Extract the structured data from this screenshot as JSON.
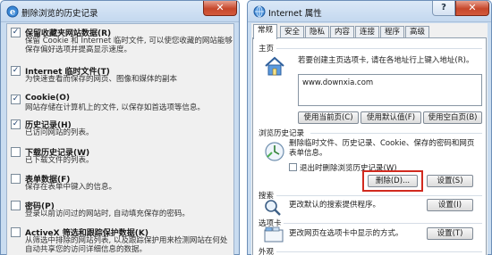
{
  "left_dialog": {
    "title": "删除浏览的历史记录",
    "close_glyph": "✕",
    "options": [
      {
        "label": "保留收藏夹网站数据(R)",
        "description": "保留 Cookie 和 Internet 临时文件, 可以使您收藏的网站能够保存偏好选项并提高显示速度。",
        "checked": true
      },
      {
        "label": "Internet 临时文件(T)",
        "description": "为快速查看而保存的网页、图像和媒体的副本",
        "checked": true
      },
      {
        "label": "Cookie(O)",
        "description": "网站存储在计算机上的文件, 以保存如首选项等信息。",
        "checked": true
      },
      {
        "label": "历史记录(H)",
        "description": "已访问网站的列表。",
        "checked": true
      },
      {
        "label": "下载历史记录(W)",
        "description": "已下载文件的列表。",
        "checked": false
      },
      {
        "label": "表单数据(F)",
        "description": "保存在表单中键入的信息。",
        "checked": false
      },
      {
        "label": "密码(P)",
        "description": "登录以前访问过的网站时, 自动填充保存的密码。",
        "checked": false
      },
      {
        "label": "ActiveX 筛选和跟踪保护数据(K)",
        "description": "从筛选中排除的网站列表, 以及跟踪保护用来检测网站在何处自动共享您的访问详细信息的数据。",
        "checked": false
      }
    ]
  },
  "right_dialog": {
    "title": "Internet 属性",
    "help_glyph": "?",
    "close_glyph": "✕",
    "tabs": [
      "常规",
      "安全",
      "隐私",
      "内容",
      "连接",
      "程序",
      "高级"
    ],
    "active_tab": 0,
    "home": {
      "label": "主页",
      "text": "若要创建主页选项卡, 请在各地址行上键入地址(R)。",
      "url": "www.downxia.com",
      "buttons": [
        "使用当前页(C)",
        "使用默认值(F)",
        "使用空白页(B)"
      ]
    },
    "history": {
      "label": "浏览历史记录",
      "text_lines": [
        "删除临时文件、历史记录、Cookie、保存的密码和网页",
        "表单信息。"
      ],
      "exit_checkbox": "退出时删除浏览历史记录(W)",
      "delete_button": "删除(D)...",
      "settings_button": "设置(S)"
    },
    "search": {
      "label": "搜索",
      "text": "更改默认的搜索提供程序。",
      "settings_button": "设置(I)"
    },
    "tabs_section": {
      "label": "选项卡",
      "text": "更改网页在选项卡中显示的方式。",
      "settings_button": "设置(T)"
    },
    "appearance": {
      "label": "外观"
    }
  },
  "colors": {
    "highlight_red": "#d12a1f",
    "frame_blue": "#c9dcf0"
  }
}
